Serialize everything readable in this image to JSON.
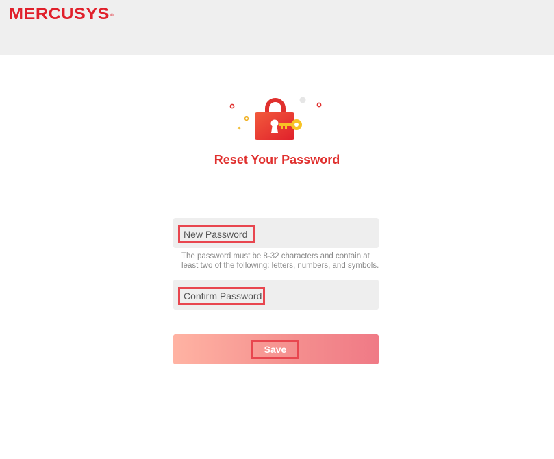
{
  "brand": {
    "name": "MERCUSYS",
    "trademark": "®",
    "color": "#e0202b"
  },
  "illustration": {
    "icon": "lock-and-key-icon",
    "accent": "#e8333a",
    "key_color": "#f7c325"
  },
  "page": {
    "title": "Reset Your Password"
  },
  "form": {
    "new_password": {
      "placeholder": "New Password"
    },
    "hint": "The password must be 8-32 characters and contain at least two of the following: letters, numbers, and symbols.",
    "confirm_password": {
      "placeholder": "Confirm Password"
    },
    "save_label": "Save"
  }
}
